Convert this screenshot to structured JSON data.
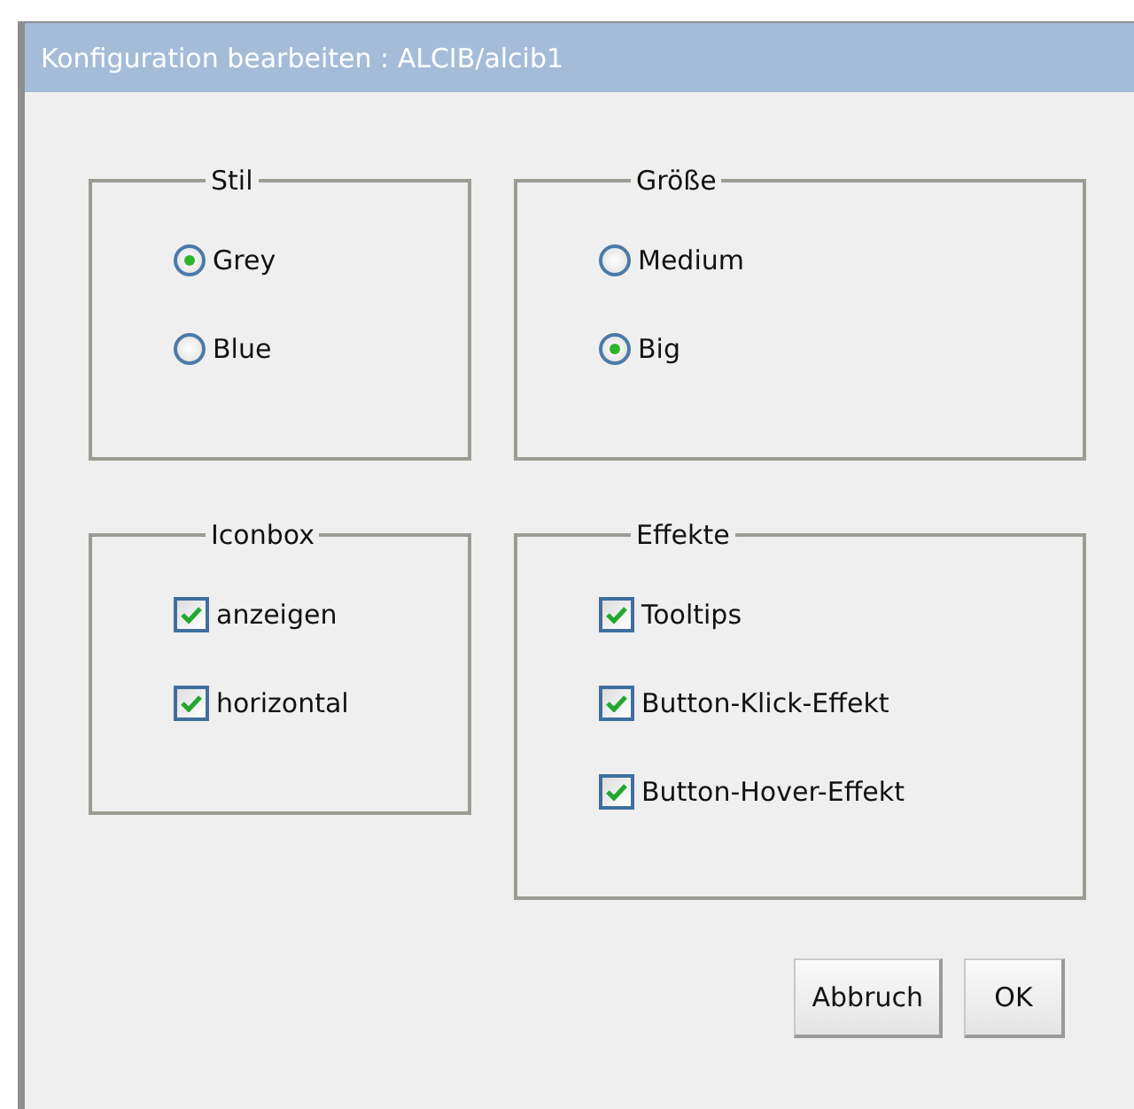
{
  "window": {
    "title": "Konfiguration bearbeiten : ALCIB/alcib1"
  },
  "groups": [
    {
      "title": "Stil",
      "kind": "radio",
      "options": [
        {
          "label": "Grey",
          "selected": true
        },
        {
          "label": "Blue",
          "selected": false
        }
      ]
    },
    {
      "title": "Größe",
      "kind": "radio",
      "options": [
        {
          "label": "Medium",
          "selected": false
        },
        {
          "label": "Big",
          "selected": true
        }
      ]
    },
    {
      "title": "Iconbox",
      "kind": "checkbox",
      "options": [
        {
          "label": "anzeigen",
          "checked": true
        },
        {
          "label": "horizontal",
          "checked": true
        }
      ]
    },
    {
      "title": "Effekte",
      "kind": "checkbox",
      "options": [
        {
          "label": "Tooltips",
          "checked": true
        },
        {
          "label": "Button-Klick-Effekt",
          "checked": true
        },
        {
          "label": "Button-Hover-Effekt",
          "checked": true
        }
      ]
    }
  ],
  "buttons": [
    "Abbruch",
    "OK"
  ]
}
